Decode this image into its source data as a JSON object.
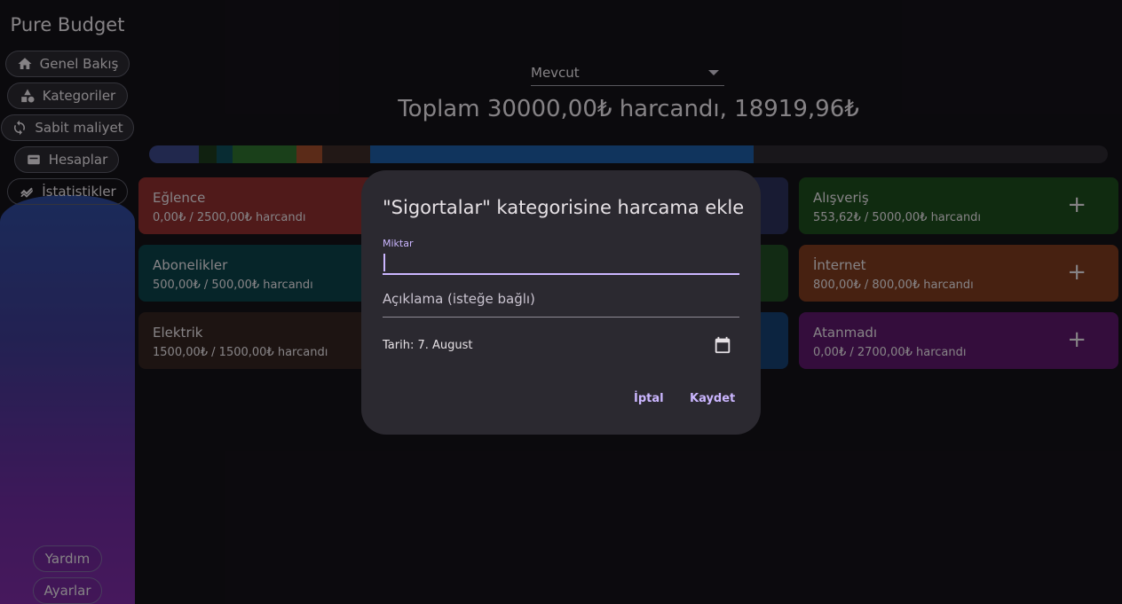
{
  "app": {
    "title": "Pure Budget"
  },
  "sidebar": {
    "items": [
      {
        "label": "Genel Bakış",
        "icon": "home-icon"
      },
      {
        "label": "Kategoriler",
        "icon": "shapes-icon"
      },
      {
        "label": "Sabit maliyet",
        "icon": "repeat-icon"
      },
      {
        "label": "Hesaplar",
        "icon": "wallet-icon"
      },
      {
        "label": "İstatistikler",
        "icon": "stats-icon"
      }
    ],
    "footer": {
      "help": "Yardım",
      "settings": "Ayarlar"
    }
  },
  "main": {
    "period_select": "Mevcut",
    "total_text": "Toplam 30000,00₺ harcandı, 18919,96₺",
    "budget_bar": {
      "segments": [
        {
          "color": "#3a4585",
          "share": 0.052
        },
        {
          "color": "#1d3a1d",
          "share": 0.018
        },
        {
          "color": "#0e4d58",
          "share": 0.017
        },
        {
          "color": "#2e6e2e",
          "share": 0.067
        },
        {
          "color": "#9e4a2a",
          "share": 0.027
        },
        {
          "color": "#3b2a26",
          "share": 0.05
        },
        {
          "color": "#1c5aa0",
          "share": 0.4
        }
      ]
    },
    "cards": [
      {
        "title": "Eğlence",
        "sub": "0,00₺ / 2500,00₺ harcandı",
        "color": "#8a2e2e"
      },
      {
        "title": "Alışveriş",
        "sub": "553,62₺ / 5000,00₺ harcandı",
        "color": "#1c4a1c"
      },
      {
        "title": "Abonelikler",
        "sub": "500,00₺ / 500,00₺ harcandı",
        "color": "#0b4048"
      },
      {
        "title": "İnternet",
        "sub": "800,00₺ / 800,00₺ harcandı",
        "color": "#7a3a1e"
      },
      {
        "title": "Elektrik",
        "sub": "1500,00₺ / 1500,00₺ harcandı",
        "color": "#332420"
      },
      {
        "title": "Atanmadı",
        "sub": "0,00₺ / 2700,00₺ harcandı",
        "color": "#5a1868"
      }
    ],
    "plus_label": "+"
  },
  "dialog": {
    "title": "\"Sigortalar\" kategorisine harcama ekle",
    "amount_label": "Miktar",
    "amount_value": "",
    "description_placeholder": "Açıklama (isteğe bağlı)",
    "date_text": "Tarih: 7. August",
    "cancel_label": "İptal",
    "save_label": "Kaydet"
  }
}
